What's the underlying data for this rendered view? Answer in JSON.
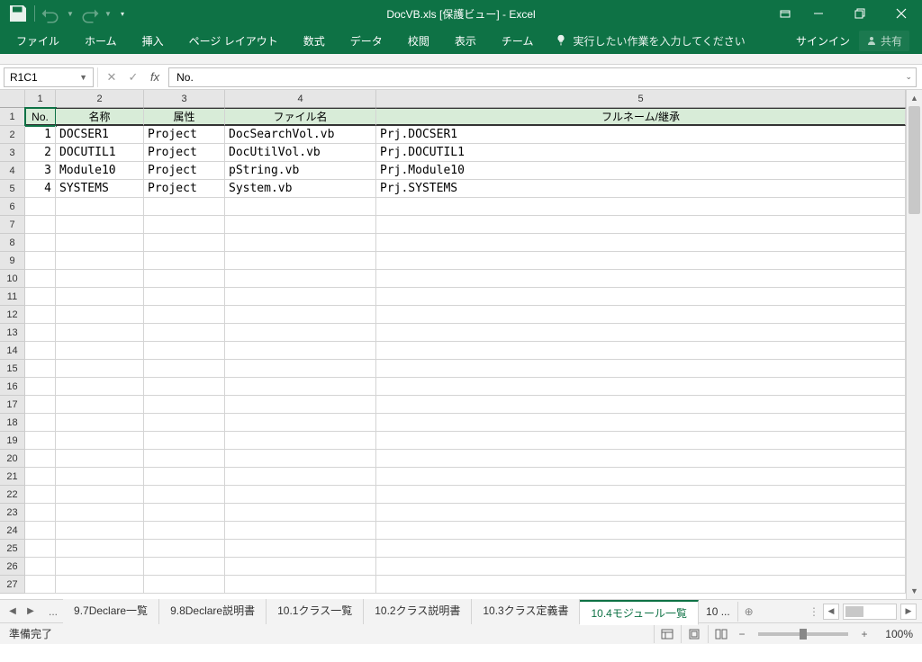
{
  "title": "DocVB.xls  [保護ビュー] - Excel",
  "ribbon": {
    "tabs": [
      "ファイル",
      "ホーム",
      "挿入",
      "ページ レイアウト",
      "数式",
      "データ",
      "校閲",
      "表示",
      "チーム"
    ],
    "tell_me": "実行したい作業を入力してください",
    "signin": "サインイン",
    "share": "共有"
  },
  "namebox": "R1C1",
  "formula": "No.",
  "col_headers": [
    "1",
    "2",
    "3",
    "4",
    "5"
  ],
  "headers": [
    "No.",
    "名称",
    "属性",
    "ファイル名",
    "フルネーム/継承"
  ],
  "rows": [
    {
      "no": "1",
      "name": "DOCSER1",
      "attr": "Project",
      "file": "DocSearchVol.vb",
      "full": "Prj.DOCSER1"
    },
    {
      "no": "2",
      "name": "DOCUTIL1",
      "attr": "Project",
      "file": "DocUtilVol.vb",
      "full": "Prj.DOCUTIL1"
    },
    {
      "no": "3",
      "name": "Module10",
      "attr": "Project",
      "file": "pString.vb",
      "full": "Prj.Module10"
    },
    {
      "no": "4",
      "name": "SYSTEMS",
      "attr": "Project",
      "file": "System.vb",
      "full": "Prj.SYSTEMS"
    }
  ],
  "empty_rows": [
    "6",
    "7",
    "8",
    "9",
    "10",
    "11",
    "12",
    "13",
    "14",
    "15",
    "16",
    "17",
    "18",
    "19",
    "20",
    "21",
    "22",
    "23",
    "24",
    "25",
    "26",
    "27"
  ],
  "tabs": {
    "items": [
      "9.7Declare一覧",
      "9.8Declare説明書",
      "10.1クラス一覧",
      "10.2クラス説明書",
      "10.3クラス定義書",
      "10.4モジュール一覧"
    ],
    "active": 5,
    "overflow": "10 ..."
  },
  "status": "準備完了",
  "zoom": "100%"
}
